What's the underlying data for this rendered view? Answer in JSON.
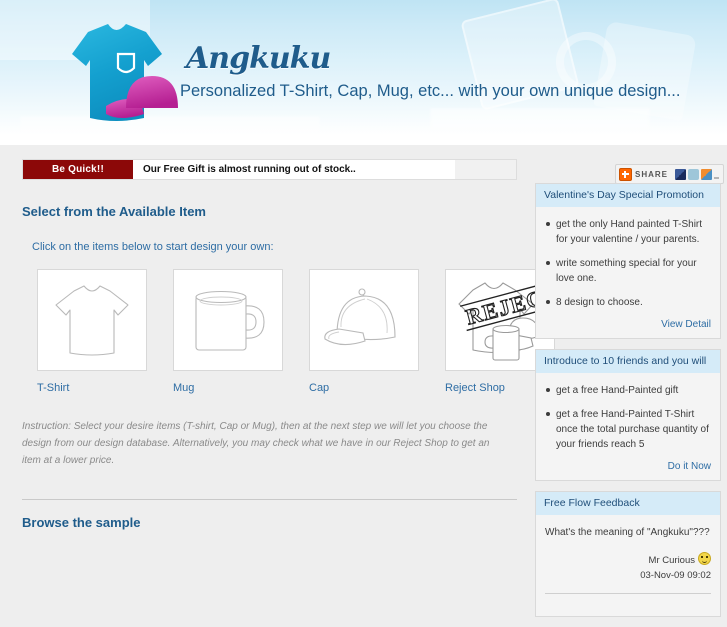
{
  "header": {
    "brand_name": "Angkuku",
    "tagline": "Personalized T-Shirt, Cap, Mug, etc... with your own unique design...",
    "logo_icon": "tshirt-cap-logo",
    "brand_color": "#1f5c8b",
    "accent_cyan": "#18a6d4",
    "accent_magenta": "#c52a9e"
  },
  "share": {
    "label": "SHARE",
    "plus_icon": "addthis-plus-icon",
    "icons": [
      "facebook-icon",
      "twitter-icon",
      "mixx-icon",
      "more-icon"
    ]
  },
  "alert": {
    "badge": "Be Quick!!",
    "message": "Our Free Gift is almost running out of stock..",
    "badge_color": "#8c0808"
  },
  "main": {
    "section_title": "Select from the Available Item",
    "instruction_lead": "Click on the items below to start design your own:",
    "products": [
      {
        "label": "T-Shirt",
        "icon": "tshirt-outline-icon"
      },
      {
        "label": "Mug",
        "icon": "mug-outline-icon"
      },
      {
        "label": "Cap",
        "icon": "cap-outline-icon"
      },
      {
        "label": "Reject Shop",
        "icon": "reject-stamp-icon"
      }
    ],
    "instruction": "Instruction: Select your desire items (T-shirt, Cap or Mug), then at the next step we will let you choose the design from our design database. Alternatively, you may check what we have in our Reject Shop to get an item at a lower price.",
    "browse_title": "Browse the sample"
  },
  "sidebar": {
    "boxes": [
      {
        "title": "Valentine's Day Special Promotion",
        "bullets": [
          "get the only Hand painted T-Shirt for your valentine / your parents.",
          "write something special for your love one.",
          "8 design to choose."
        ],
        "link": "View Detail"
      },
      {
        "title": "Introduce to 10 friends and you will",
        "bullets": [
          "get a free Hand-Painted gift",
          "get a free Hand-Painted T-Shirt once the total purchase quantity of your friends reach 5"
        ],
        "link": "Do it Now"
      },
      {
        "title": "Free Flow Feedback",
        "question": "What's the meaning of \"Angkuku\"???",
        "author": "Mr Curious",
        "author_icon": "smiley-icon",
        "timestamp": "03-Nov-09 09:02"
      }
    ]
  }
}
